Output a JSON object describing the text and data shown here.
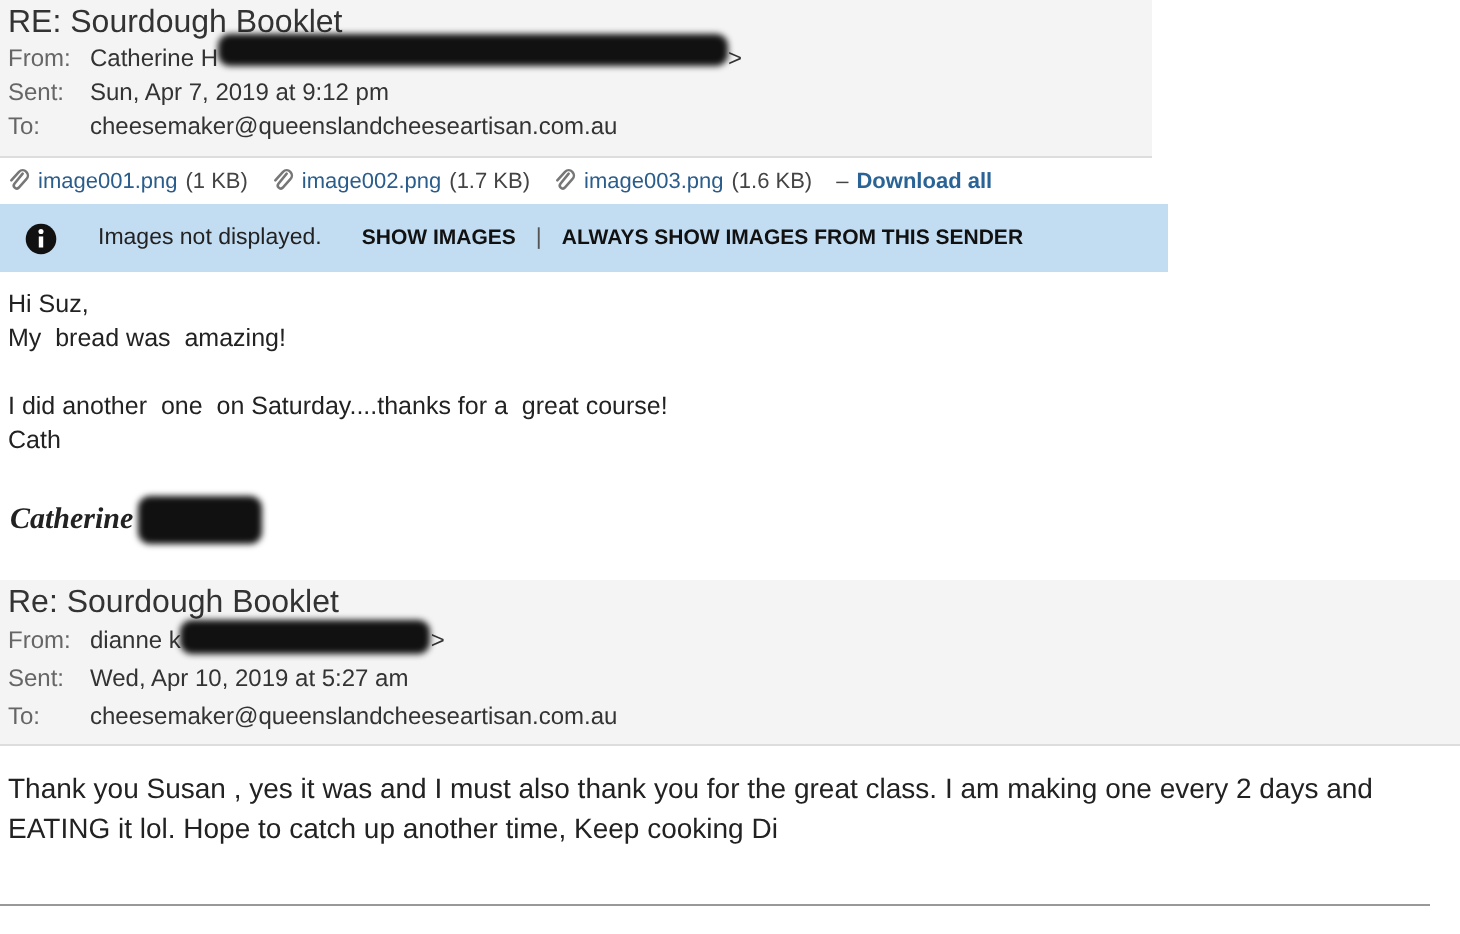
{
  "messages": [
    {
      "kind": "first",
      "subject": "RE: Sourdough Booklet",
      "fields": [
        {
          "label": "From:",
          "value": "Catherine H",
          "redacted": true,
          "suffix": ">"
        },
        {
          "label": "Sent:",
          "value": "Sun, Apr 7, 2019 at 9:12 pm",
          "redacted": false
        },
        {
          "label": "To:",
          "value": "cheesemaker@queenslandcheeseartisan.com.au",
          "redacted": false
        }
      ],
      "attachments": [
        {
          "name": "image001.png",
          "size": "(1 KB)"
        },
        {
          "name": "image002.png",
          "size": "(1.7 KB)"
        },
        {
          "name": "image003.png",
          "size": "(1.6 KB)"
        }
      ],
      "download_dash": "–",
      "download_all": "Download all",
      "notice": {
        "text": "Images not displayed.",
        "actions": [
          "SHOW IMAGES",
          "ALWAYS SHOW IMAGES FROM THIS SENDER"
        ],
        "separator": "|"
      },
      "paragraphs": [
        [
          "Hi Suz,",
          "My  bread was  amazing!"
        ],
        [
          "I did another  one  on Saturday....thanks for a  great course!",
          "Cath"
        ]
      ],
      "signature": {
        "text": "Catherine",
        "redacted": true
      }
    },
    {
      "kind": "reply",
      "subject": "Re: Sourdough Booklet",
      "fields": [
        {
          "label": "From:",
          "value": "dianne k",
          "redacted": true,
          "suffix": ">"
        },
        {
          "label": "Sent:",
          "value": "Wed, Apr 10, 2019 at 5:27 am",
          "redacted": false
        },
        {
          "label": "To:",
          "value": "cheesemaker@queenslandcheeseartisan.com.au",
          "redacted": false
        }
      ],
      "paragraphs": [
        [
          "Thank you Susan , yes it was and I must also thank you for the great class. I am making one every 2 days and EATING it lol. Hope to catch up another time, Keep cooking Di"
        ]
      ]
    }
  ]
}
